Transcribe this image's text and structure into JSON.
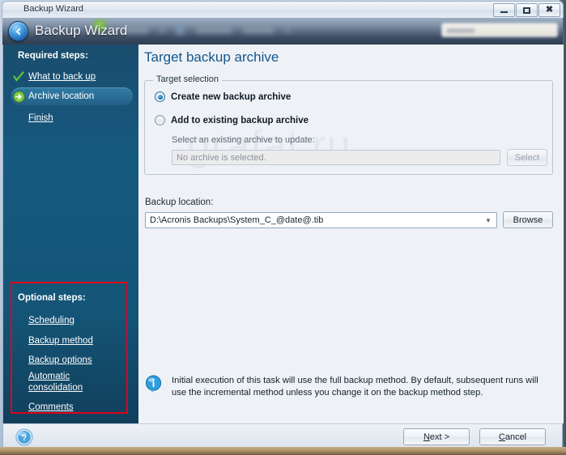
{
  "window": {
    "title": "Backup Wizard",
    "minimize_label": "Minimize",
    "maximize_label": "Maximize",
    "close_label": "Close"
  },
  "header": {
    "app_title": "Backup Wizard",
    "back_label": "Back"
  },
  "sidebar": {
    "required_heading": "Required steps:",
    "required_items": [
      {
        "label": "What to back up",
        "state": "completed",
        "icon": "check-icon"
      },
      {
        "label": "Archive location",
        "state": "current",
        "icon": "green-arrow-icon"
      },
      {
        "label": "Finish",
        "state": "pending",
        "icon": "none"
      }
    ],
    "optional_heading": "Optional steps:",
    "optional_items": [
      {
        "label": "Scheduling"
      },
      {
        "label": "Backup method"
      },
      {
        "label": "Backup options"
      },
      {
        "label": "Automatic consolidation"
      },
      {
        "label": "Comments"
      }
    ],
    "annotation_color": "#e2001a"
  },
  "content": {
    "page_title": "Target backup archive",
    "groupbox_title": "Target selection",
    "radio_create": "Create new backup archive",
    "radio_add": "Add to existing backup archive",
    "selected_radio": "create",
    "select_archive_hint": "Select an existing archive to update:",
    "archive_value": "No archive is selected.",
    "select_button": "Select",
    "backup_location_label": "Backup location:",
    "backup_location_value": "D:\\Acronis Backups\\System_C_@date@.tib",
    "browse_button": "Browse",
    "info_text": "Initial execution of this task will use the full backup method. By default, subsequent runs will use the incremental method unless you change it on the backup method step.",
    "watermark": "grafat.ru"
  },
  "footer": {
    "help_label": "Help",
    "next_button": "Next >",
    "cancel_button": "Cancel"
  },
  "colors": {
    "sidebar_bg": "#145577",
    "title_blue": "#15568c",
    "accent_red": "#e2001a",
    "selected_item": "#2b6f97"
  }
}
